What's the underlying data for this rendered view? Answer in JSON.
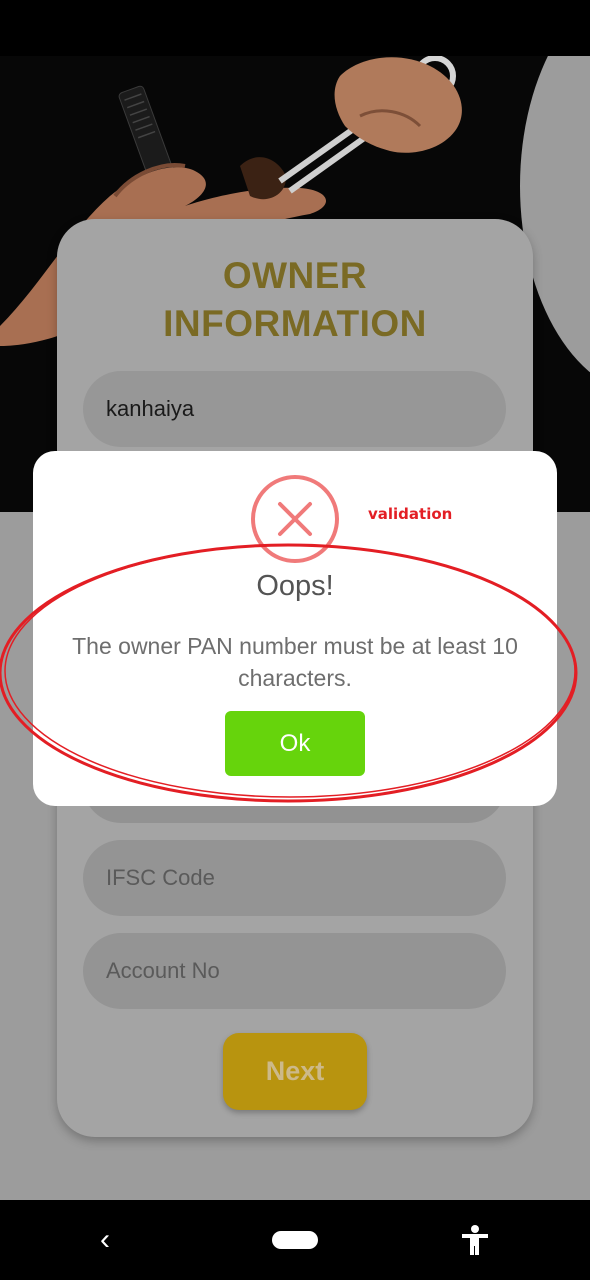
{
  "owner_form": {
    "title": "OWNER\nINFORMATION",
    "name_value": "kanhaiya",
    "ifsc_placeholder": "IFSC Code",
    "account_placeholder": "Account No",
    "next_label": "Next"
  },
  "dialog": {
    "icon": "error-x-icon",
    "title": "Oops!",
    "message": "The owner PAN number must be at least 10 characters.",
    "ok_label": "Ok"
  },
  "annotation": {
    "label": "validation",
    "color": "#e31e24"
  },
  "colors": {
    "title_gold": "#7a6a24",
    "next_button": "#b8940f",
    "ok_button": "#66d40c",
    "error_red": "#f07a7a"
  },
  "nav": {
    "icons": [
      "back-icon",
      "home-pill-icon",
      "accessibility-icon"
    ]
  }
}
